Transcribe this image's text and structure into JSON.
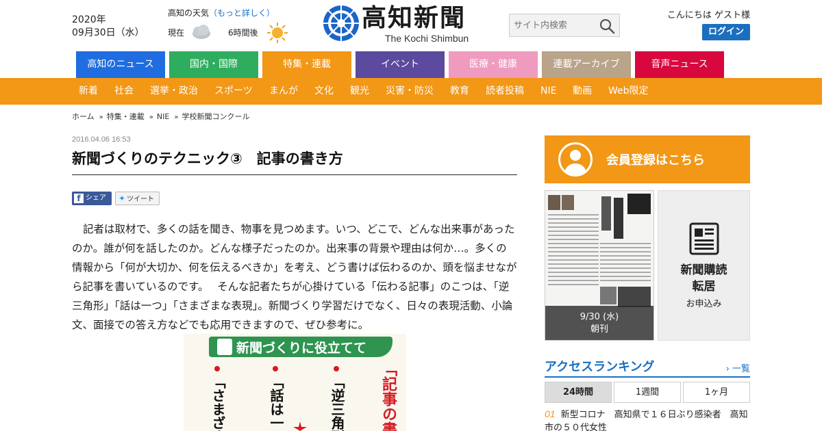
{
  "header": {
    "year": "2020年",
    "date": "09月30日（水）",
    "weather_title": "高知の天気",
    "weather_more": "（もっと詳しく）",
    "weather_now": "現在",
    "weather_later": "6時間後",
    "logo_title": "高知新聞",
    "logo_sub": "The Kochi Shimbun",
    "search_placeholder": "サイト内検索",
    "greeting": "こんにちは ゲスト様",
    "login": "ログイン"
  },
  "tabs": [
    "高知のニュース",
    "国内・国際",
    "特集・連載",
    "イベント",
    "医療・健康",
    "連載アーカイブ",
    "音声ニュース"
  ],
  "subnav": [
    "新着",
    "社会",
    "選挙・政治",
    "スポーツ",
    "まんが",
    "文化",
    "観光",
    "災害・防災",
    "教育",
    "読者投稿",
    "NIE",
    "動画",
    "Web限定"
  ],
  "breadcrumb": [
    "ホーム",
    "特集・連載",
    "NIE",
    "学校新聞コンクール"
  ],
  "article": {
    "date": "2016.04.06 16:53",
    "title": "新聞づくりのテクニック③　記事の書き方",
    "share_fb": "シェア",
    "share_tw": "ツイート",
    "body": "記者は取材で、多くの話を聞き、物事を見つめます。いつ、どこで、どんな出来事があったのか。誰が何を話したのか。どんな様子だったのか。出来事の背景や理由は何か…。多くの情報から「何が大切か、何を伝えるべきか」を考え、どう書けば伝わるのか、頭を悩ませながら記事を書いているのです。　 そんな記者たちが心掛けている「伝わる記事」のこつは、「逆三角形」「話は一つ」「さまざまな表現」。新聞づくり学習だけでなく、日々の表現活動、小論文、面接での答え方などでも応用できますので、ぜひ参考に。",
    "image": {
      "banner": "新聞づくりに役立てて",
      "col1": "「記事の書き",
      "col2": "「逆三角形",
      "col3": "「話は一つ",
      "col4": "「さまざま"
    }
  },
  "sidebar": {
    "member": "会員登録はこちら",
    "paper_date": "9/30 (水)",
    "paper_edition": "朝刊",
    "subscribe_title1": "新聞購読",
    "subscribe_title2": "転居",
    "subscribe_small": "お申込み",
    "ranking_title": "アクセスランキング",
    "ranking_more": "一覧",
    "ranking_tabs": [
      "24時間",
      "1週間",
      "1ヶ月"
    ],
    "ranking_items": [
      {
        "num": "01",
        "text": "新型コロナ　高知県で１６日ぶり感染者　高知市の５０代女性"
      }
    ]
  },
  "colors": {
    "accent_orange": "#f29716",
    "link_blue": "#1a6fc0"
  }
}
